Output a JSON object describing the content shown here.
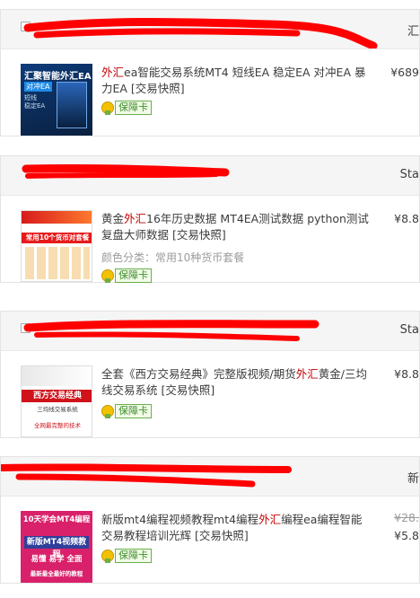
{
  "orders": [
    {
      "header_right": "汇",
      "item": {
        "title_parts": [
          {
            "text": "外汇",
            "hl": true
          },
          {
            "text": "ea智能交易系统MT4 短线EA 稳定EA 对冲EA 暴力EA [交易快照]",
            "hl": false
          }
        ],
        "variant": "",
        "badge": "保障卡",
        "price": "¥689",
        "price_original": ""
      },
      "thumb": {
        "line1": "汇聚智能外汇EA",
        "line2": "对冲EA",
        "line3": "短线\n稳定EA"
      }
    },
    {
      "header_right": "Sta",
      "item": {
        "title_parts": [
          {
            "text": "黄金",
            "hl": false
          },
          {
            "text": "外汇",
            "hl": true
          },
          {
            "text": "16年历史数据 MT4EA测试数据 python测试 复盘大师数据 [交易快照]",
            "hl": false
          }
        ],
        "variant": "颜色分类：常用10种货币套餐",
        "badge": "保障卡",
        "price": "¥8.8",
        "price_original": ""
      },
      "thumb": {
        "band": "常用10个货币对套餐"
      }
    },
    {
      "header_right": "Sta",
      "item": {
        "title_parts": [
          {
            "text": "全套《西方交易经典》完整版视频/期货",
            "hl": false
          },
          {
            "text": "外汇",
            "hl": true
          },
          {
            "text": "黄金/三均线交易系统 [交易快照]",
            "hl": false
          }
        ],
        "variant": "",
        "badge": "保障卡",
        "price": "¥8.8",
        "price_original": ""
      },
      "thumb": {
        "band": "西方交易经典",
        "line1": "三均线交易系统",
        "line2": "全网最完整的技术"
      }
    },
    {
      "header_right": "新",
      "item": {
        "title_parts": [
          {
            "text": "新版mt4编程视频教程mt4编程",
            "hl": false
          },
          {
            "text": "外汇",
            "hl": true
          },
          {
            "text": "编程ea编程智能交易教程培训光辉 [交易快照]",
            "hl": false
          }
        ],
        "variant": "",
        "badge": "保障卡",
        "price": "¥5.8",
        "price_original": "¥28."
      },
      "thumb": {
        "line1": "10天学会MT4编程",
        "box": "新版MT4视频教程",
        "line2": "易懂 易学 全面",
        "line3": "最新最全最好的教程"
      }
    }
  ]
}
